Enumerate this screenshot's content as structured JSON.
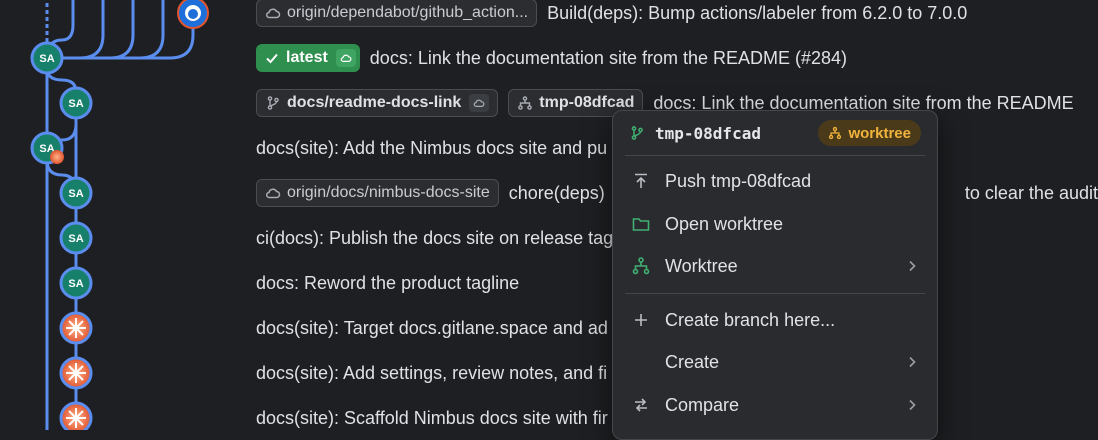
{
  "graph": {
    "avatar_initials": "SA",
    "colors": {
      "line": "#5b8def",
      "avatar_bg": "#17806a",
      "avatar_border": "#5b8def",
      "agent_bg": "#e0552f",
      "github_bg": "#1e6fd9"
    }
  },
  "rows": [
    {
      "refs": [
        {
          "label": "origin/dependabot/github_action...",
          "icon": "cloud-icon"
        }
      ],
      "message": "Build(deps): Bump actions/labeler from 6.2.0 to 7.0.0"
    },
    {
      "refs": [
        {
          "label": "latest",
          "icon": "check-icon"
        }
      ],
      "message": "docs: Link the documentation site from the README (#284)"
    },
    {
      "refs": [
        {
          "label": "docs/readme-docs-link",
          "icon": "branch-icon"
        },
        {
          "label": "tmp-08dfcad",
          "icon": "worktree-icon"
        }
      ],
      "message": "docs: Link the documentation site from the README"
    },
    {
      "refs": [],
      "message": "docs(site): Add the Nimbus docs site and pu"
    },
    {
      "refs": [
        {
          "label": "origin/docs/nimbus-docs-site",
          "icon": "cloud-icon"
        }
      ],
      "message": "chore(deps)",
      "message_tail": "to clear the audit"
    },
    {
      "refs": [],
      "message": "ci(docs): Publish the docs site on release tag"
    },
    {
      "refs": [],
      "message": "docs: Reword the product tagline"
    },
    {
      "refs": [],
      "message": "docs(site): Target docs.gitlane.space and ad"
    },
    {
      "refs": [],
      "message": "docs(site): Add settings, review notes, and fi"
    },
    {
      "refs": [],
      "message": "docs(site): Scaffold Nimbus docs site with fir"
    }
  ],
  "context_menu": {
    "branch": "tmp-08dfcad",
    "badge": "worktree",
    "items": [
      {
        "label": "Push tmp-08dfcad",
        "icon": "push-icon",
        "submenu": false
      },
      {
        "label": "Open worktree",
        "icon": "folder-icon",
        "submenu": false
      },
      {
        "label": "Worktree",
        "icon": "worktree-icon",
        "submenu": true
      },
      {
        "label": "Create branch here...",
        "icon": "plus-icon",
        "submenu": false
      },
      {
        "label": "Create",
        "icon": "",
        "submenu": true
      },
      {
        "label": "Compare",
        "icon": "compare-icon",
        "submenu": true
      }
    ]
  }
}
